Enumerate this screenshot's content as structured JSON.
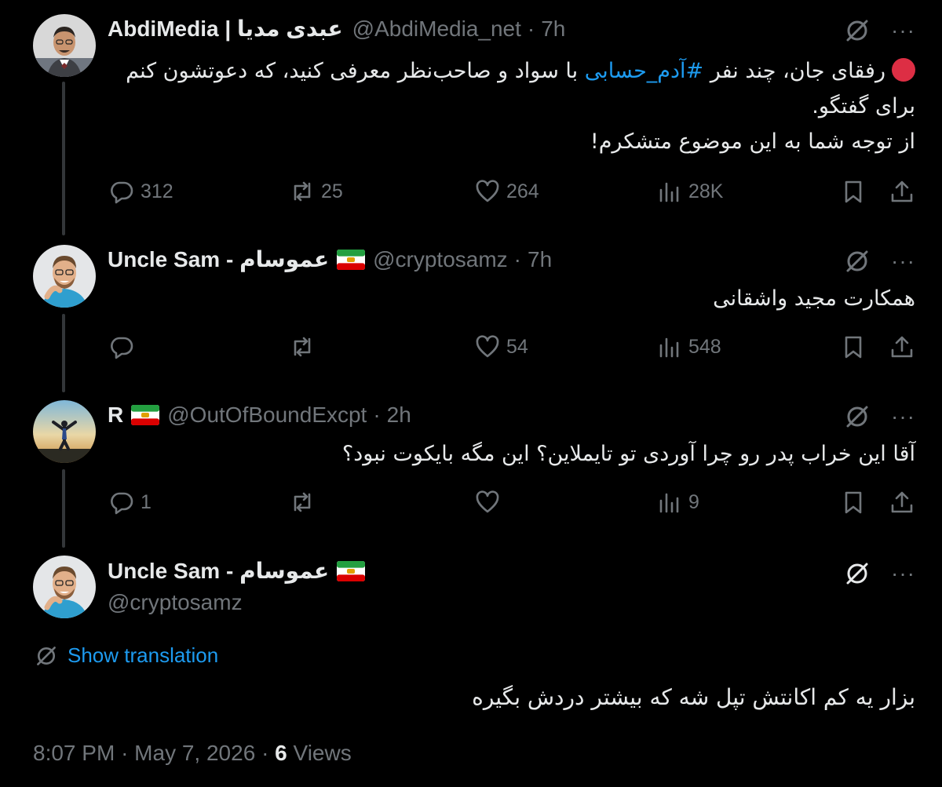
{
  "tweets": [
    {
      "name": "AbdiMedia | عبدی مدیا",
      "handle": "@AbdiMedia_net",
      "dot": "·",
      "time": "7h",
      "text_before": "رفقای جان، چند نفر ",
      "hashtag": "#آدم_حسابی",
      "text_after": " با سواد و صاحب‌نظر معرفی کنید، که دعوتشون کنم برای گفتگو.",
      "text_line2": "از توجه شما به این موضوع متشکرم!",
      "replies": "312",
      "reposts": "25",
      "likes": "264",
      "views": "28K"
    },
    {
      "name": "Uncle Sam - عموسام",
      "handle": "@cryptosamz",
      "dot": "·",
      "time": "7h",
      "text": "همکارت مجید واشقانی",
      "replies": "",
      "reposts": "",
      "likes": "54",
      "views": "548"
    },
    {
      "name": "R",
      "handle": "@OutOfBoundExcpt",
      "dot": "·",
      "time": "2h",
      "text": "آقا این خراب پدر رو چرا آوردی تو تایملاین؟ این مگه بایکوت نبود؟",
      "replies": "1",
      "reposts": "",
      "likes": "",
      "views": "9"
    }
  ],
  "main": {
    "name": "Uncle Sam - عموسام",
    "handle": "@cryptosamz",
    "show_translation": "Show translation",
    "text": "بزار یه کم اکانتش تپل شه که بیشتر دردش بگیره",
    "time": "8:07 PM",
    "dot": "·",
    "date": "May 7, 2026",
    "views_count": "6",
    "views_label": "Views"
  },
  "colors": {
    "background": "#000000",
    "text": "#e7e9ea",
    "muted": "#71767b",
    "link": "#1d9bf0",
    "thread_line": "#333639"
  },
  "icons": [
    "grok-icon",
    "more-icon",
    "reply-icon",
    "repost-icon",
    "like-icon",
    "views-icon",
    "bookmark-icon",
    "share-icon",
    "translate-icon",
    "iran-flag-icon"
  ]
}
